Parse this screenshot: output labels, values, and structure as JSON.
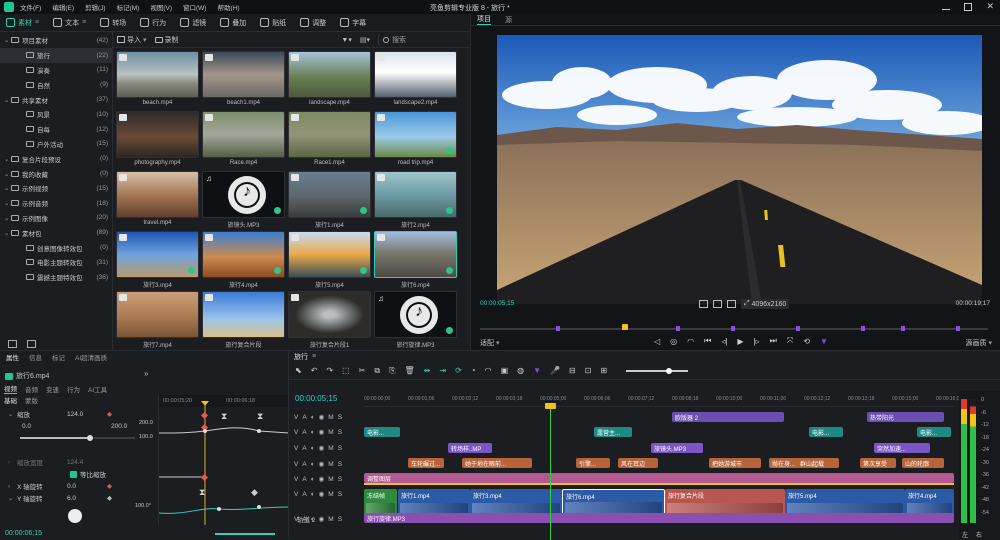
{
  "app": {
    "title": "亮鱼剪辑专业版 8 - 旅行 *"
  },
  "menu": [
    "文件(F)",
    "编辑(E)",
    "剪辑(J)",
    "标记(M)",
    "视图(V)",
    "窗口(W)",
    "帮助(H)"
  ],
  "toolbar": {
    "tabs": [
      "素材",
      "文本",
      "转场",
      "行为",
      "滤镜",
      "叠加",
      "贴纸",
      "调整",
      "字幕"
    ],
    "export_label": "导出"
  },
  "sidebar": {
    "items": [
      {
        "label": "项目素材",
        "count": "(42)",
        "level": 0
      },
      {
        "label": "旅行",
        "count": "(22)",
        "level": 1,
        "selected": true
      },
      {
        "label": "演奏",
        "count": "(11)",
        "level": 1
      },
      {
        "label": "自然",
        "count": "(9)",
        "level": 1
      },
      {
        "label": "共享素材",
        "count": "(37)",
        "level": 0
      },
      {
        "label": "风景",
        "count": "(10)",
        "level": 1
      },
      {
        "label": "自每",
        "count": "(12)",
        "level": 1
      },
      {
        "label": "户外活动",
        "count": "(15)",
        "level": 1
      },
      {
        "label": "复合片段预设",
        "count": "(0)",
        "level": 0
      },
      {
        "label": "我的收藏",
        "count": "(0)",
        "level": 0
      },
      {
        "label": "示例视频",
        "count": "(15)",
        "level": 0
      },
      {
        "label": "示例音频",
        "count": "(18)",
        "level": 0
      },
      {
        "label": "示例图像",
        "count": "(20)",
        "level": 0
      },
      {
        "label": "素材包",
        "count": "(89)",
        "level": 0
      },
      {
        "label": "创意图像转效包",
        "count": "(0)",
        "level": 1
      },
      {
        "label": "电影主题转效包",
        "count": "(31)",
        "level": 1
      },
      {
        "label": "震撼主题特效包",
        "count": "(36)",
        "level": 1
      }
    ]
  },
  "media": {
    "toolbar": {
      "import_label": "导入",
      "record_label": "录制",
      "search_placeholder": "搜索"
    },
    "items": [
      {
        "label": "beach.mp4",
        "kind": "beach"
      },
      {
        "label": "beach1.mp4",
        "kind": "beach1"
      },
      {
        "label": "landscape.mp4",
        "kind": "landscape"
      },
      {
        "label": "landscape2.mp4",
        "kind": "clouds"
      },
      {
        "label": "photography.mp4",
        "kind": "photo"
      },
      {
        "label": "Race.mp4",
        "kind": "race"
      },
      {
        "label": "Race1.mp4",
        "kind": "race1"
      },
      {
        "label": "road trip.mp4",
        "kind": "roadtrip",
        "check": true
      },
      {
        "label": "travel.mp4",
        "kind": "travel"
      },
      {
        "label": "旅镜头.MP3",
        "kind": "audio",
        "check": true
      },
      {
        "label": "旅行1.mp4",
        "kind": "road",
        "check": true
      },
      {
        "label": "旅行2.mp4",
        "kind": "curve",
        "check": true
      },
      {
        "label": "旅行3.mp4",
        "kind": "road3",
        "check": true
      },
      {
        "label": "旅行4.mp4",
        "kind": "canyon",
        "check": true
      },
      {
        "label": "旅行5.mp4",
        "kind": "sunset",
        "check": true
      },
      {
        "label": "旅行6.mp4",
        "kind": "desert",
        "check": true
      },
      {
        "label": "旅行7.mp4",
        "kind": "dunes"
      },
      {
        "label": "旅行复合片段",
        "kind": "sky"
      },
      {
        "label": "旅行复合片段1",
        "kind": "tunnel"
      },
      {
        "label": "旅行旋律.MP3",
        "kind": "audio",
        "check": true
      }
    ]
  },
  "preview": {
    "tabs": [
      "项目",
      "源"
    ],
    "current_time": "00:00:05;15",
    "total_time": "00:00:19;17",
    "resolution": "4096x2160",
    "quality": "适配",
    "zoom": "源画质"
  },
  "properties": {
    "tabs": [
      "属性",
      "信息",
      "标记",
      "AI超清画质"
    ],
    "clip_name": "旅行6.mp4",
    "subtabs": [
      "视频",
      "音频",
      "变速",
      "行为",
      "AI工具"
    ],
    "subsub": [
      "基础",
      "蒙版"
    ],
    "rows": [
      {
        "label": "缩放",
        "value": "124.0"
      },
      {
        "label": "0.0",
        "value": "200.0"
      },
      {
        "label": "缩放宽度",
        "value": "124.4"
      },
      {
        "label": "等比缩放",
        "value": ""
      },
      {
        "label": "X 轴旋转",
        "value": "0.0"
      },
      {
        "label": "Y 轴旋转",
        "value": "6.0"
      }
    ],
    "kf_time_a": "00:00:05;20",
    "kf_time_b": "00:00:06;18",
    "graph_max": "200.0",
    "graph_mid": "100.0",
    "graph_max_b": "100.0°",
    "footer_time": "00:00:06;15"
  },
  "timeline": {
    "tab": "旅行",
    "timecode": "00:00:05;15",
    "ruler": [
      "00:00:00;00",
      "00:00:01;06",
      "00:00:02;12",
      "00:00:03;18",
      "00:00:05;00",
      "00:00:06;06",
      "00:00:07;12",
      "00:00:08;18",
      "00:00:10;00",
      "00:00:11;06",
      "00:00:12;12",
      "00:00:13;18",
      "00:00:15;00",
      "00:00:16;06"
    ],
    "track_label_v2": "轨道 2",
    "clips": {
      "r1": [
        {
          "label": "欧版器 2"
        },
        {
          "label": "热带阳光"
        }
      ],
      "r2": [
        {
          "label": "电影..."
        },
        {
          "label": "露营主..."
        },
        {
          "label": "电影..."
        },
        {
          "label": "电影..."
        }
      ],
      "r3": [
        {
          "label": "转场样..MP"
        },
        {
          "label": "旅镜头.MP3"
        },
        {
          "label": "突然加速..."
        }
      ],
      "r4": [
        {
          "label": "车轮碾过..."
        },
        {
          "label": "她于地在眼前..."
        },
        {
          "label": "引擎..."
        },
        {
          "label": "风在耳边"
        },
        {
          "label": "把她游城市"
        },
        {
          "label": "抛在身..."
        },
        {
          "label": "群山起载"
        },
        {
          "label": "第次享受"
        },
        {
          "label": "山的轮廓"
        }
      ],
      "r5": [
        {
          "label": "调整图层"
        }
      ],
      "r6": [
        {
          "label": "冻结帧"
        },
        {
          "label": "旅行1.mp4"
        },
        {
          "label": "旅行3.mp4"
        },
        {
          "label": "旅行6.mp4"
        },
        {
          "label": "旅行复合片段"
        },
        {
          "label": "旅行5.mp4"
        },
        {
          "label": "旅行4.mp4"
        }
      ],
      "r7": [
        {
          "label": "旅行旋律.MP3"
        }
      ]
    },
    "meter_labels": [
      "左",
      "右"
    ],
    "db_labels": [
      "0",
      "-6",
      "-12",
      "-18",
      "-24",
      "-30",
      "-36",
      "-42",
      "-48",
      "-54"
    ]
  }
}
